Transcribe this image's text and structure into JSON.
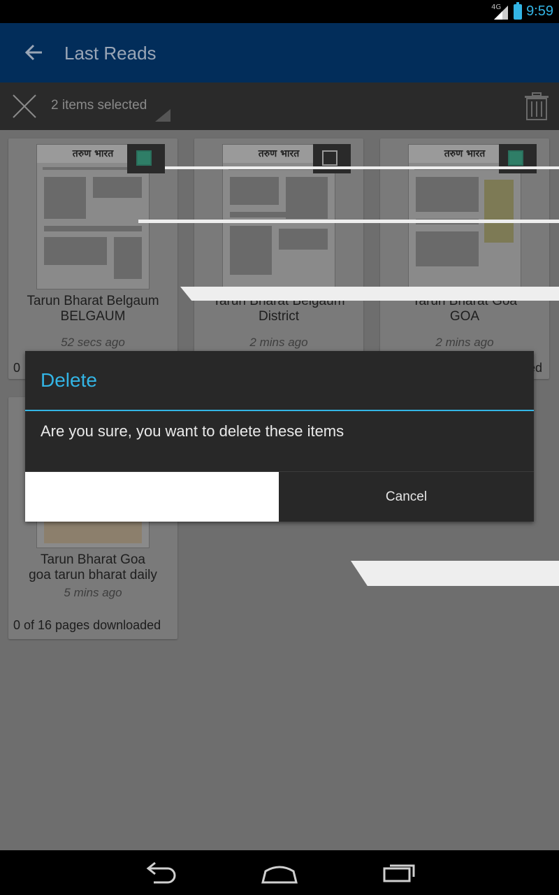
{
  "status_bar": {
    "time": "9:59",
    "network": "4G"
  },
  "app_bar": {
    "title": "Last Reads"
  },
  "action_bar": {
    "selection_label": "2 items selected"
  },
  "cards": [
    {
      "title": "Tarun Bharat Belgaum",
      "subtitle": "BELGAUM",
      "time": "52 secs ago",
      "status": "0",
      "checked": true,
      "masthead": "तरुण भारत"
    },
    {
      "title": "Tarun Bharat Belgaum",
      "subtitle": "District",
      "time": "2 mins ago",
      "status": "",
      "checked": false,
      "masthead": "तरुण भारत"
    },
    {
      "title": "Tarun Bharat Goa",
      "subtitle": "GOA",
      "time": "2 mins ago",
      "status": "ed",
      "checked": true,
      "masthead": "तरुण भारत"
    },
    {
      "title": "Tarun Bharat Goa",
      "subtitle": "goa tarun bharat daily",
      "time": "5 mins ago",
      "status": "0 of 16 pages downloaded",
      "checked": false,
      "masthead": ""
    }
  ],
  "dialog": {
    "title": "Delete",
    "message": "Are you sure, you want to delete these items",
    "confirm_label": "",
    "cancel_label": "Cancel"
  },
  "colors": {
    "accent": "#33b5e5",
    "app_bar": "#022d5a",
    "checked": "#2f7e67"
  }
}
